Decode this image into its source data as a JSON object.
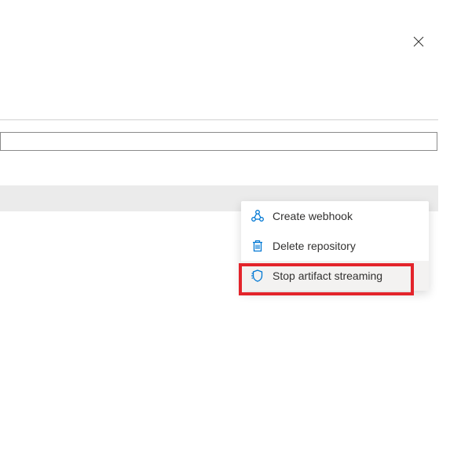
{
  "close_label": "Close",
  "menu": {
    "items": [
      {
        "icon": "webhook-icon",
        "label": "Create webhook"
      },
      {
        "icon": "delete-icon",
        "label": "Delete repository"
      },
      {
        "icon": "streaming-icon",
        "label": "Stop artifact streaming"
      }
    ]
  },
  "colors": {
    "icon_blue": "#0078d4",
    "highlight_red": "#e3242b"
  }
}
